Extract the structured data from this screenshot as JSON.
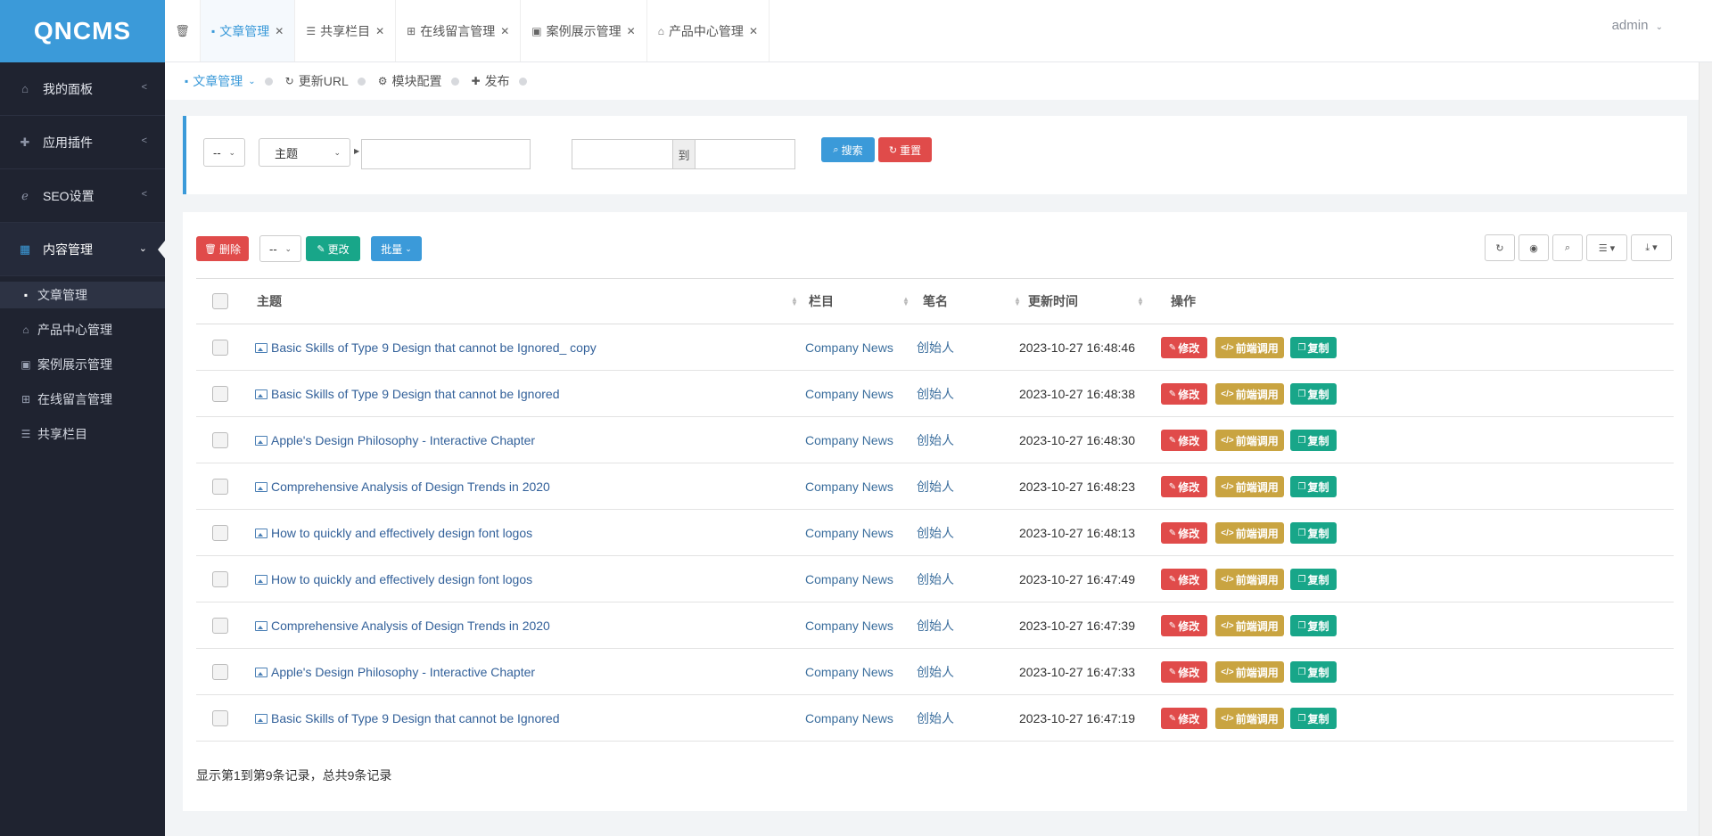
{
  "app": {
    "logo": "QNCMS"
  },
  "sidebar": {
    "groups": [
      {
        "label": "我的面板",
        "icon": "home-icon"
      },
      {
        "label": "应用插件",
        "icon": "puzzle-icon"
      },
      {
        "label": "SEO设置",
        "icon": "ie-icon"
      },
      {
        "label": "内容管理",
        "icon": "grid-icon"
      }
    ],
    "sub_items": [
      {
        "label": "文章管理",
        "icon": "document-icon"
      },
      {
        "label": "产品中心管理",
        "icon": "shop-icon"
      },
      {
        "label": "案例展示管理",
        "icon": "file-image-icon"
      },
      {
        "label": "在线留言管理",
        "icon": "table-icon"
      },
      {
        "label": "共享栏目",
        "icon": "list-icon"
      }
    ]
  },
  "tabs": [
    {
      "label": "文章管理",
      "icon": "document-icon"
    },
    {
      "label": "共享栏目",
      "icon": "list-icon"
    },
    {
      "label": "在线留言管理",
      "icon": "table-icon"
    },
    {
      "label": "案例展示管理",
      "icon": "file-image-icon"
    },
    {
      "label": "产品中心管理",
      "icon": "shop-icon"
    }
  ],
  "user": {
    "name": "admin"
  },
  "breadcrumb": [
    {
      "label": "文章管理",
      "icon": "document-icon"
    },
    {
      "label": "更新URL",
      "icon": "refresh-icon"
    },
    {
      "label": "模块配置",
      "icon": "cog-icon"
    },
    {
      "label": "发布",
      "icon": "plus-icon"
    }
  ],
  "search": {
    "scope_value": "--",
    "field_value": "主题",
    "keyword_value": "",
    "date_sep": "到",
    "search_label": "搜索",
    "reset_label": "重置"
  },
  "toolbar": {
    "delete_label": "删除",
    "status_value": "--",
    "change_label": "更改",
    "batch_label": "批量"
  },
  "table": {
    "columns": [
      "主题",
      "栏目",
      "笔名",
      "更新时间",
      "操作"
    ],
    "rows": [
      {
        "title": "Basic Skills of Type 9 Design that cannot be Ignored_ copy",
        "column": "Company News",
        "author": "创始人",
        "time": "2023-10-27 16:48:46"
      },
      {
        "title": "Basic Skills of Type 9 Design that cannot be Ignored",
        "column": "Company News",
        "author": "创始人",
        "time": "2023-10-27 16:48:38"
      },
      {
        "title": "Apple's Design Philosophy - Interactive Chapter",
        "column": "Company News",
        "author": "创始人",
        "time": "2023-10-27 16:48:30"
      },
      {
        "title": "Comprehensive Analysis of Design Trends in 2020",
        "column": "Company News",
        "author": "创始人",
        "time": "2023-10-27 16:48:23"
      },
      {
        "title": "How to quickly and effectively design font logos",
        "column": "Company News",
        "author": "创始人",
        "time": "2023-10-27 16:48:13"
      },
      {
        "title": "How to quickly and effectively design font logos",
        "column": "Company News",
        "author": "创始人",
        "time": "2023-10-27 16:47:49"
      },
      {
        "title": "Comprehensive Analysis of Design Trends in 2020",
        "column": "Company News",
        "author": "创始人",
        "time": "2023-10-27 16:47:39"
      },
      {
        "title": "Apple's Design Philosophy - Interactive Chapter",
        "column": "Company News",
        "author": "创始人",
        "time": "2023-10-27 16:47:33"
      },
      {
        "title": "Basic Skills of Type 9 Design that cannot be Ignored",
        "column": "Company News",
        "author": "创始人",
        "time": "2023-10-27 16:47:19"
      }
    ],
    "actions": {
      "edit": "修改",
      "call": "前端调用",
      "copy": "复制"
    }
  },
  "pagination": {
    "summary": "显示第1到第9条记录，总共9条记录"
  },
  "colors": {
    "primary": "#3b9ad9",
    "danger": "#e04b4a",
    "success": "#18a689",
    "warning": "#c9a441",
    "sidebar": "#1f2330"
  }
}
